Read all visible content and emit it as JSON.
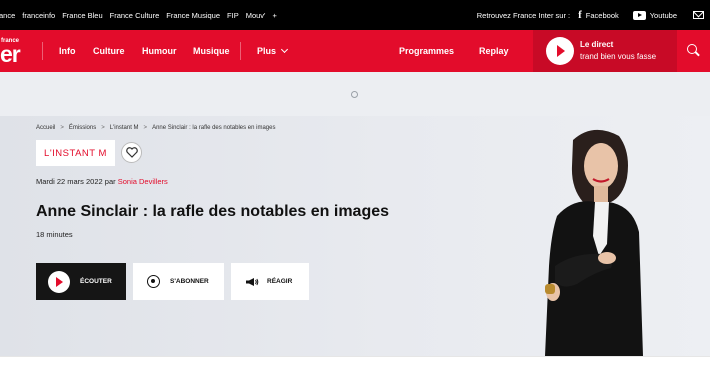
{
  "network": {
    "links": [
      "ance",
      "franceinfo",
      "France Bleu",
      "France Culture",
      "France Musique",
      "FIP",
      "Mouv'",
      "+"
    ],
    "follow_label": "Retrouvez France Inter sur :",
    "facebook": "Facebook",
    "youtube": "Youtube"
  },
  "nav": {
    "logo_small": "france",
    "logo_big": "er",
    "items": [
      "Info",
      "Culture",
      "Humour",
      "Musique"
    ],
    "more": "Plus",
    "programmes": "Programmes",
    "replay": "Replay",
    "live_title": "Le direct",
    "live_subtitle": "trand bien vous fasse"
  },
  "breadcrumb": [
    "Accueil",
    "Émissions",
    "L'instant M",
    "Anne Sinclair : la rafle des notables en images"
  ],
  "show": {
    "tag": "L'INSTANT M",
    "date": "Mardi 22 mars 2022 par",
    "author": "Sonia Devillers",
    "title": "Anne Sinclair : la rafle des notables en images",
    "duration": "18 minutes"
  },
  "actions": {
    "listen": "Écouter",
    "subscribe": "S'abonner",
    "react": "Réagir"
  },
  "colors": {
    "brand_red": "#e30c2b",
    "dark": "#151515"
  }
}
